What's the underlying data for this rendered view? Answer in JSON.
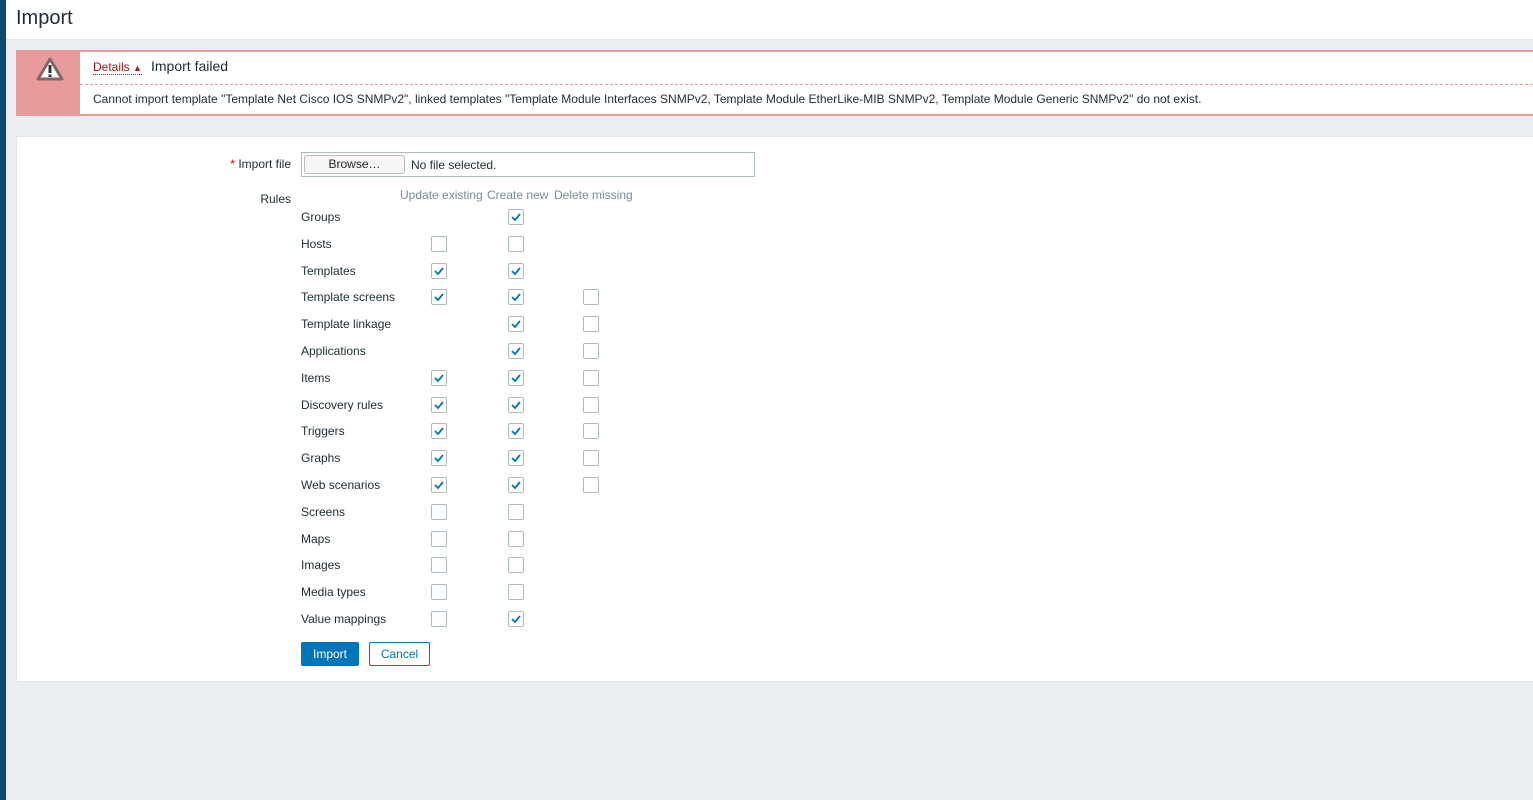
{
  "header": {
    "title": "Import"
  },
  "alert": {
    "details_label": "Details",
    "title": "Import failed",
    "message": "Cannot import template \"Template Net Cisco IOS SNMPv2\", linked templates \"Template Module Interfaces SNMPv2, Template Module EtherLike-MIB SNMPv2, Template Module Generic SNMPv2\" do not exist.",
    "color": "#e99a9c"
  },
  "form": {
    "import_file_label": "Import file",
    "required_mark": "*",
    "browse_label": "Browse…",
    "file_status": "No file selected.",
    "rules_label": "Rules",
    "columns": [
      "Update existing",
      "Create new",
      "Delete missing"
    ],
    "rules": [
      {
        "name": "Groups",
        "update": null,
        "create": true,
        "delete": null
      },
      {
        "name": "Hosts",
        "update": false,
        "create": false,
        "delete": null
      },
      {
        "name": "Templates",
        "update": true,
        "create": true,
        "delete": null
      },
      {
        "name": "Template screens",
        "update": true,
        "create": true,
        "delete": false
      },
      {
        "name": "Template linkage",
        "update": null,
        "create": true,
        "delete": false
      },
      {
        "name": "Applications",
        "update": null,
        "create": true,
        "delete": false
      },
      {
        "name": "Items",
        "update": true,
        "create": true,
        "delete": false
      },
      {
        "name": "Discovery rules",
        "update": true,
        "create": true,
        "delete": false
      },
      {
        "name": "Triggers",
        "update": true,
        "create": true,
        "delete": false
      },
      {
        "name": "Graphs",
        "update": true,
        "create": true,
        "delete": false
      },
      {
        "name": "Web scenarios",
        "update": true,
        "create": true,
        "delete": false
      },
      {
        "name": "Screens",
        "update": false,
        "create": false,
        "delete": null
      },
      {
        "name": "Maps",
        "update": false,
        "create": false,
        "delete": null
      },
      {
        "name": "Images",
        "update": false,
        "create": false,
        "delete": null
      },
      {
        "name": "Media types",
        "update": false,
        "create": false,
        "delete": null
      },
      {
        "name": "Value mappings",
        "update": false,
        "create": true,
        "delete": null
      }
    ],
    "import_button": "Import",
    "cancel_button": "Cancel"
  }
}
